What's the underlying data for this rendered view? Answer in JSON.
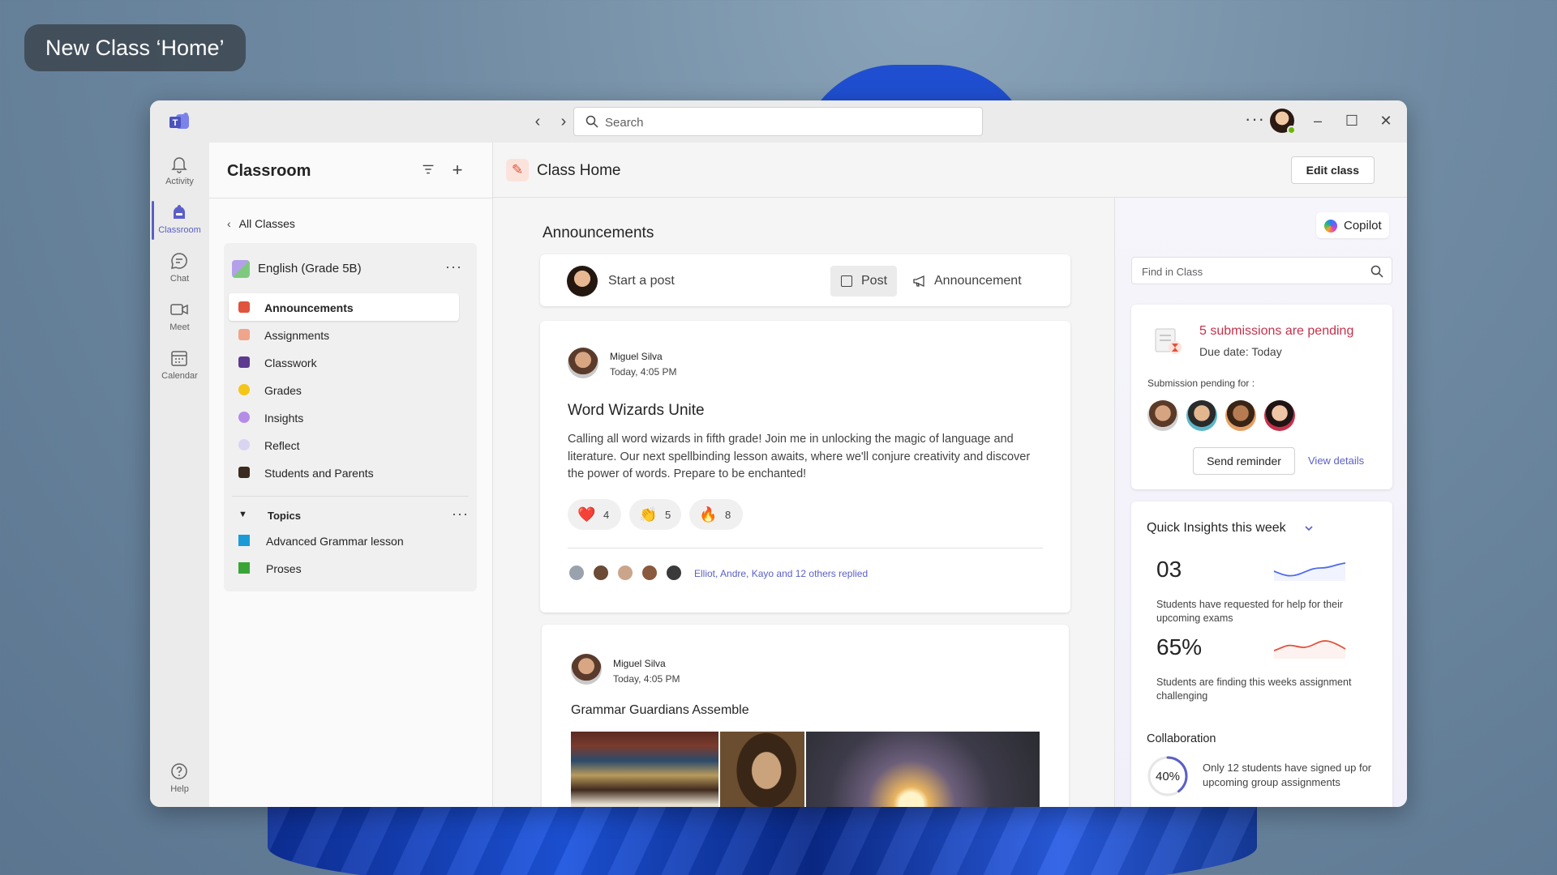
{
  "caption": "New Class ‘Home’",
  "search": {
    "placeholder": "Search"
  },
  "rail": [
    {
      "label": "Activity",
      "icon": "bell-icon"
    },
    {
      "label": "Classroom",
      "icon": "classroom-icon"
    },
    {
      "label": "Chat",
      "icon": "chat-icon"
    },
    {
      "label": "Meet",
      "icon": "video-icon"
    },
    {
      "label": "Calendar",
      "icon": "calendar-icon"
    },
    {
      "label": "Help",
      "icon": "help-icon"
    }
  ],
  "left_panel": {
    "title": "Classroom",
    "back_label": "All Classes",
    "class_name": "English (Grade 5B)",
    "nav": [
      {
        "label": "Announcements",
        "color": "#e0533c"
      },
      {
        "label": "Assignments",
        "color": "#f0a58a"
      },
      {
        "label": "Classwork",
        "color": "#5c3a8f"
      },
      {
        "label": "Grades",
        "color": "#f5c518"
      },
      {
        "label": "Insights",
        "color": "#b48ce8"
      },
      {
        "label": "Reflect",
        "color": "#d9d4f2"
      },
      {
        "label": "Students and Parents",
        "color": "#3b2a1f"
      }
    ],
    "topics_label": "Topics",
    "topics": [
      {
        "label": "Advanced Grammar lesson",
        "color": "#1a9bd8"
      },
      {
        "label": "Proses",
        "color": "#3aa537"
      }
    ]
  },
  "main": {
    "title": "Class Home",
    "edit_label": "Edit class",
    "feed_title": "Announcements",
    "composer": {
      "placeholder": "Start a post",
      "post_label": "Post",
      "announcement_label": "Announcement"
    },
    "posts": [
      {
        "author": "Miguel Silva",
        "time": "Today, 4:05 PM",
        "title": "Word Wizards Unite",
        "body": "Calling all word wizards in fifth grade! Join me in unlocking the magic of language and literature. Our next spellbinding lesson awaits, where we'll conjure creativity and discover the power of words. Prepare to be enchanted!",
        "reactions": [
          {
            "emoji": "❤️",
            "count": "4"
          },
          {
            "emoji": "👏",
            "count": "5"
          },
          {
            "emoji": "🔥",
            "count": "8"
          }
        ],
        "replies_text": "Elliot, Andre, Kayo and 12 others replied"
      },
      {
        "author": "Miguel Silva",
        "time": "Today, 4:05 PM",
        "title": "Grammar Guardians Assemble"
      }
    ]
  },
  "right_panel": {
    "copilot_label": "Copilot",
    "find_placeholder": "Find in Class",
    "submissions": {
      "title": "5 submissions are pending",
      "due": "Due date: Today",
      "pending_for": "Submission pending for :",
      "remind_label": "Send reminder",
      "details_label": "View details"
    },
    "insights": {
      "title": "Quick Insights this week",
      "metrics": [
        {
          "value": "03",
          "desc": "Students have requested for help for their upcoming exams",
          "trend_color": "#4f6bed"
        },
        {
          "value": "65%",
          "desc": "Students are finding this weeks assignment challenging",
          "trend_color": "#e0533c"
        }
      ],
      "collab_title": "Collaboration",
      "collab_value": "40%",
      "collab_fraction": 0.4,
      "collab_desc": "Only 12 students have signed up for upcoming group assignments"
    }
  }
}
